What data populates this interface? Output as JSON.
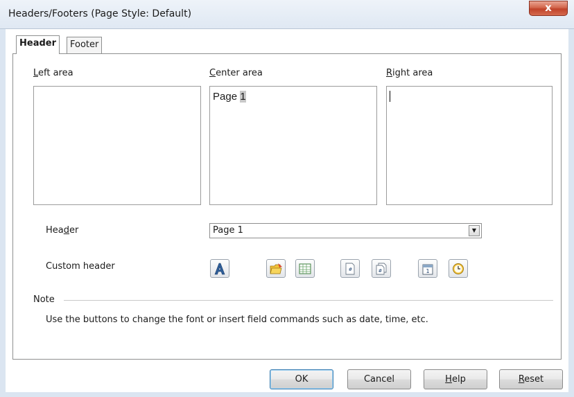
{
  "window": {
    "title": "Headers/Footers (Page Style: Default)",
    "close_glyph": "x"
  },
  "tabs": [
    {
      "label": "Header",
      "active": true
    },
    {
      "label": "Footer",
      "active": false
    }
  ],
  "areas": {
    "left": {
      "label": "Left area",
      "mnemonic": "L",
      "content": ""
    },
    "center": {
      "label": "Center area",
      "mnemonic": "C",
      "content_text": "Page ",
      "content_field": "1"
    },
    "right": {
      "label": "Right area",
      "mnemonic": "R",
      "content": ""
    }
  },
  "header_select": {
    "label_pre": "Hea",
    "label_mnemonic": "d",
    "label_post": "er",
    "value": "Page 1"
  },
  "custom_header": {
    "label": "Custom header",
    "buttons": [
      {
        "icon": "text-attributes-icon"
      },
      {
        "icon": "title-field-icon"
      },
      {
        "icon": "sheet-name-icon"
      },
      {
        "icon": "page-number-icon"
      },
      {
        "icon": "total-pages-icon"
      },
      {
        "icon": "date-icon"
      },
      {
        "icon": "time-icon"
      }
    ]
  },
  "note": {
    "title": "Note",
    "text": "Use the buttons to change the font or insert field commands such as date, time, etc."
  },
  "footer_buttons": {
    "ok": "OK",
    "cancel": "Cancel",
    "help_mnemonic": "H",
    "help_rest": "elp",
    "reset_mnemonic": "R",
    "reset_rest": "eset"
  },
  "colors": {
    "titlebar": "#dfe8f3",
    "close_button": "#c8492f",
    "default_button_border": "#3c7fb1"
  }
}
